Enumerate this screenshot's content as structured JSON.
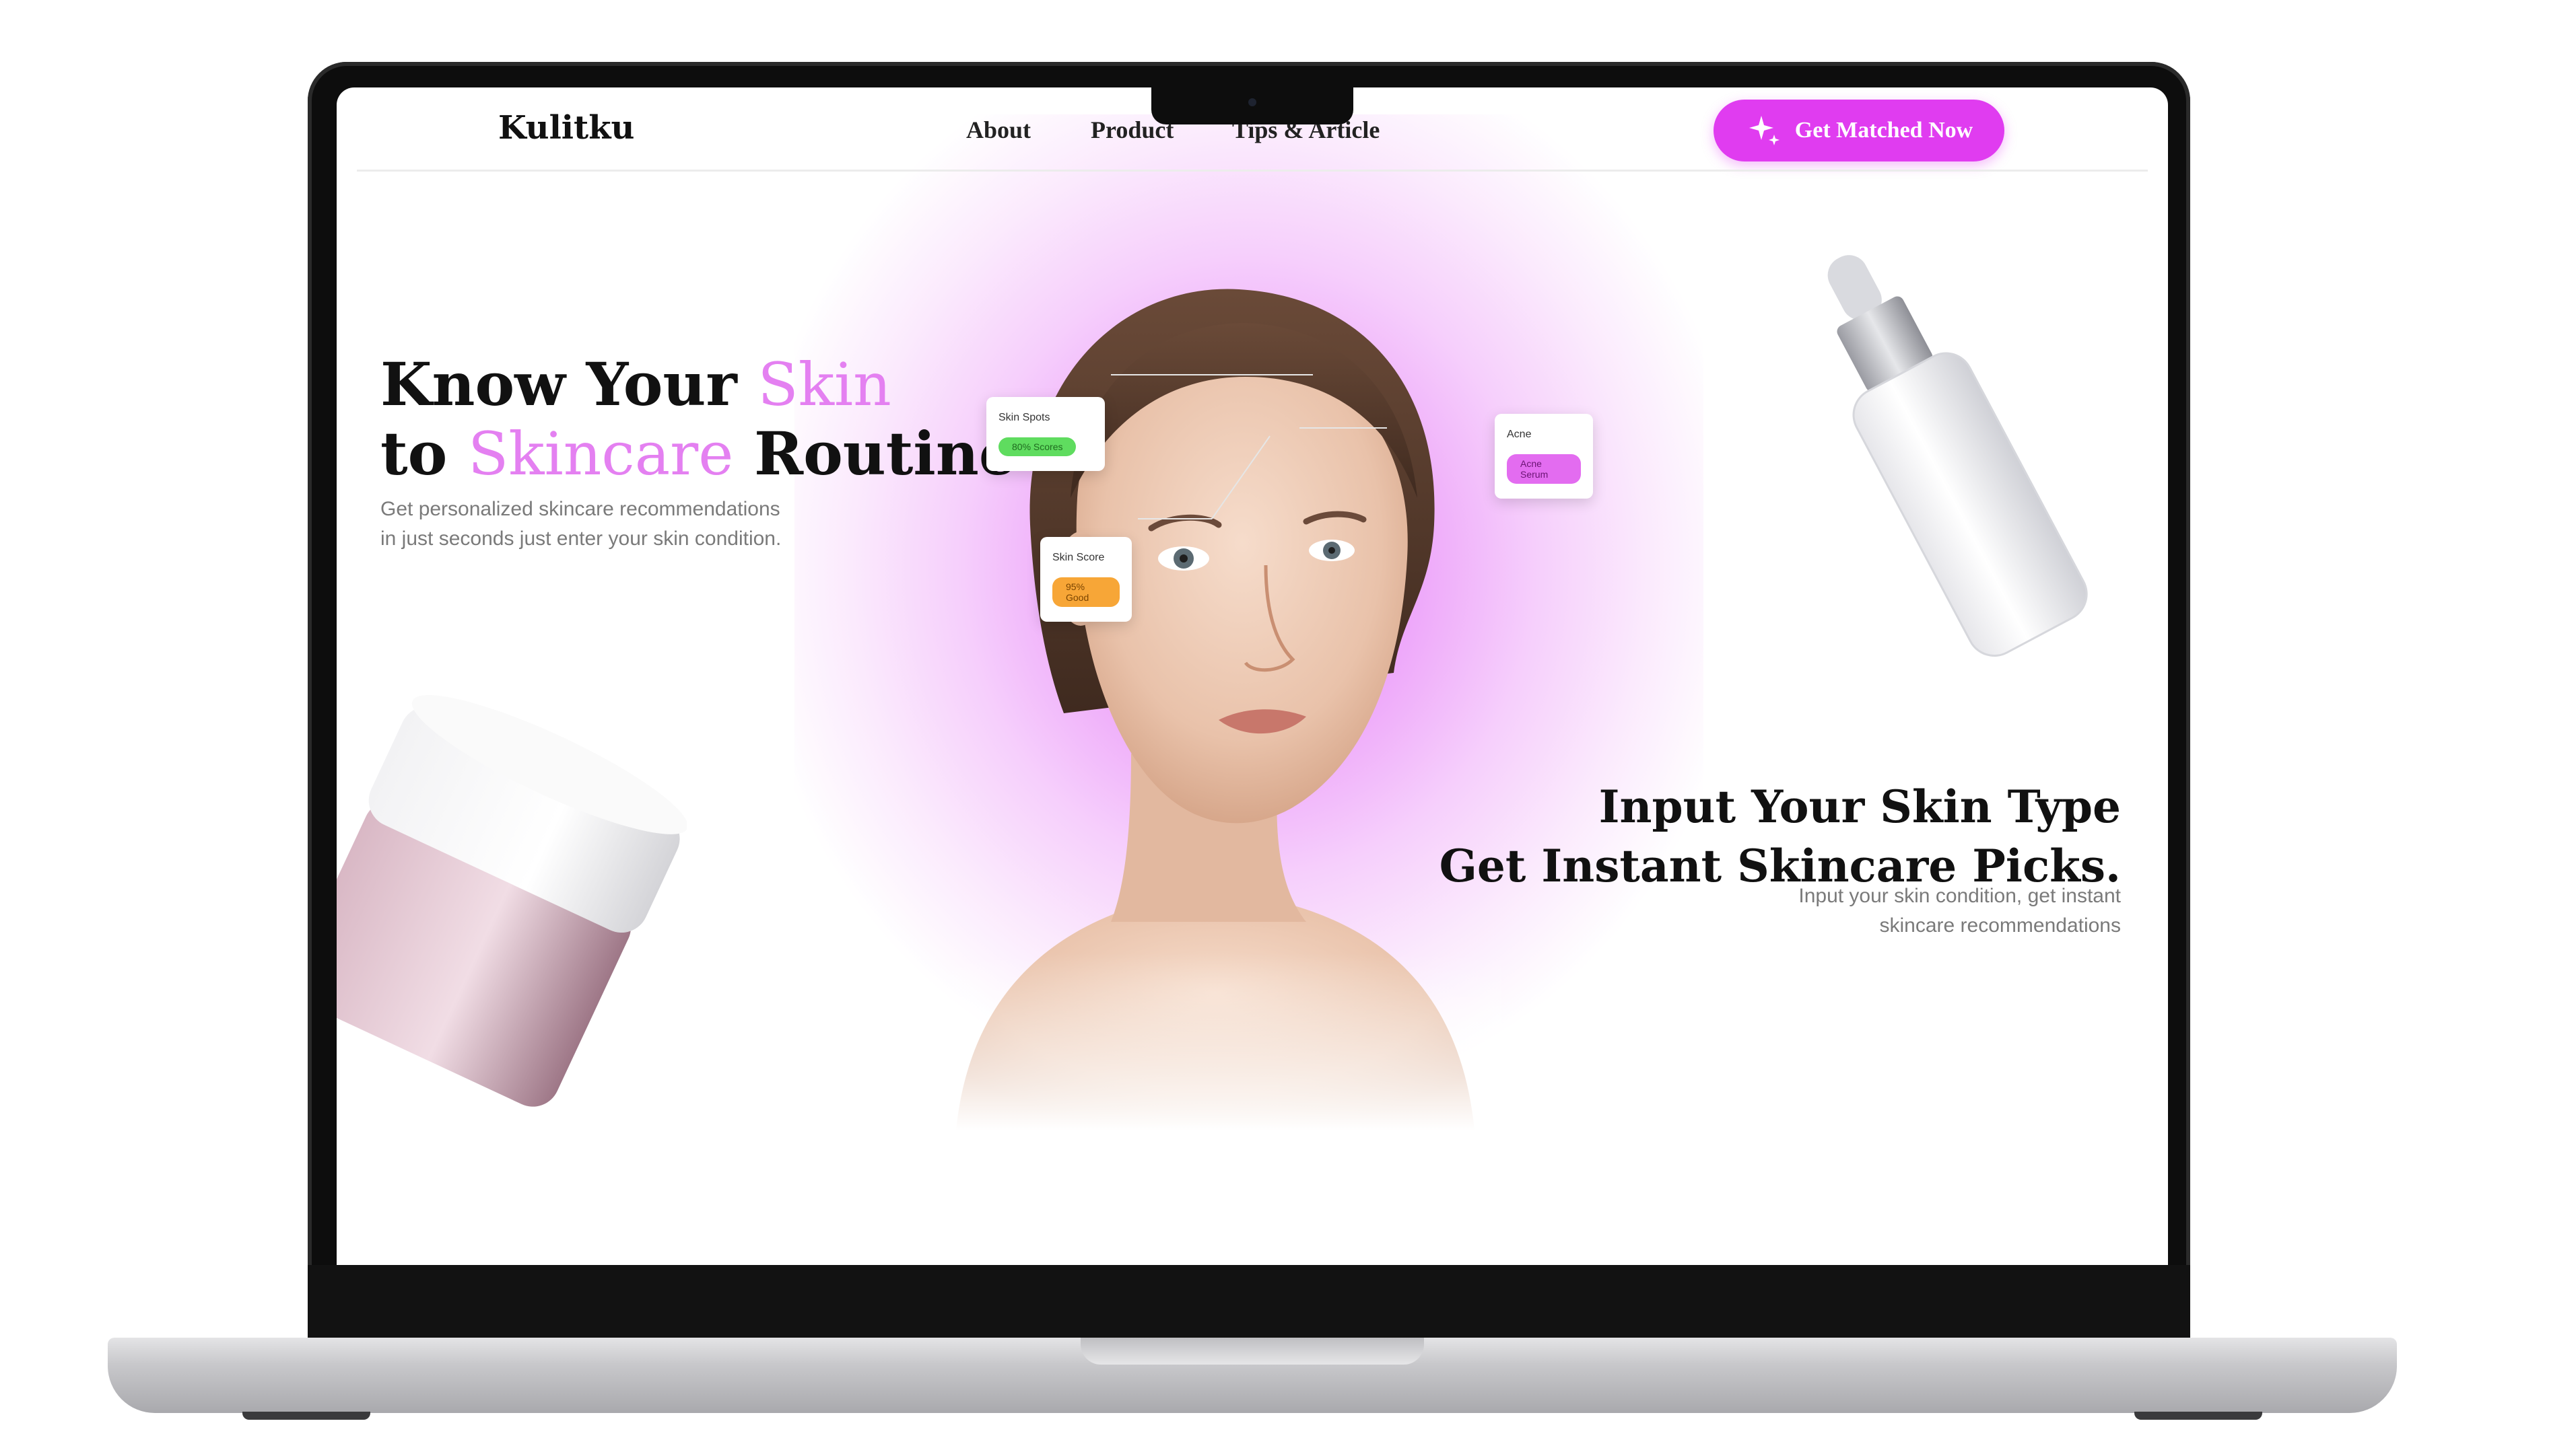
{
  "nav": {
    "logo": "Kulitku",
    "links": [
      "About",
      "Product",
      "Tips & Article"
    ],
    "cta_label": "Get Matched Now"
  },
  "hero_left": {
    "line1_plain": "Know Your ",
    "line1_accent": "Skin",
    "line2_plain_a": "to ",
    "line2_accent": "Skincare",
    "line2_plain_b": " Routine",
    "subtitle_1": "Get personalized skincare recommendations",
    "subtitle_2": "in just seconds just enter your skin condition."
  },
  "hero_right": {
    "line1": "Input Your Skin Type",
    "line2": "Get Instant Skincare Picks.",
    "subtitle_1": "Input your skin condition, get instant",
    "subtitle_2": "skincare recommendations"
  },
  "analysis_tags": [
    {
      "title": "Skin Spots",
      "value": "80% Scores",
      "color": "green"
    },
    {
      "title": "Skin Score",
      "value": "95% Good",
      "color": "orange"
    },
    {
      "title": "Acne",
      "value": "Acne Serum",
      "color": "purple"
    }
  ],
  "colors": {
    "accent_pink": "#e480f1",
    "cta": "#e03cf0",
    "glow": "#e08af7"
  },
  "icons": {
    "cta_icon": "sparkle-icon"
  }
}
